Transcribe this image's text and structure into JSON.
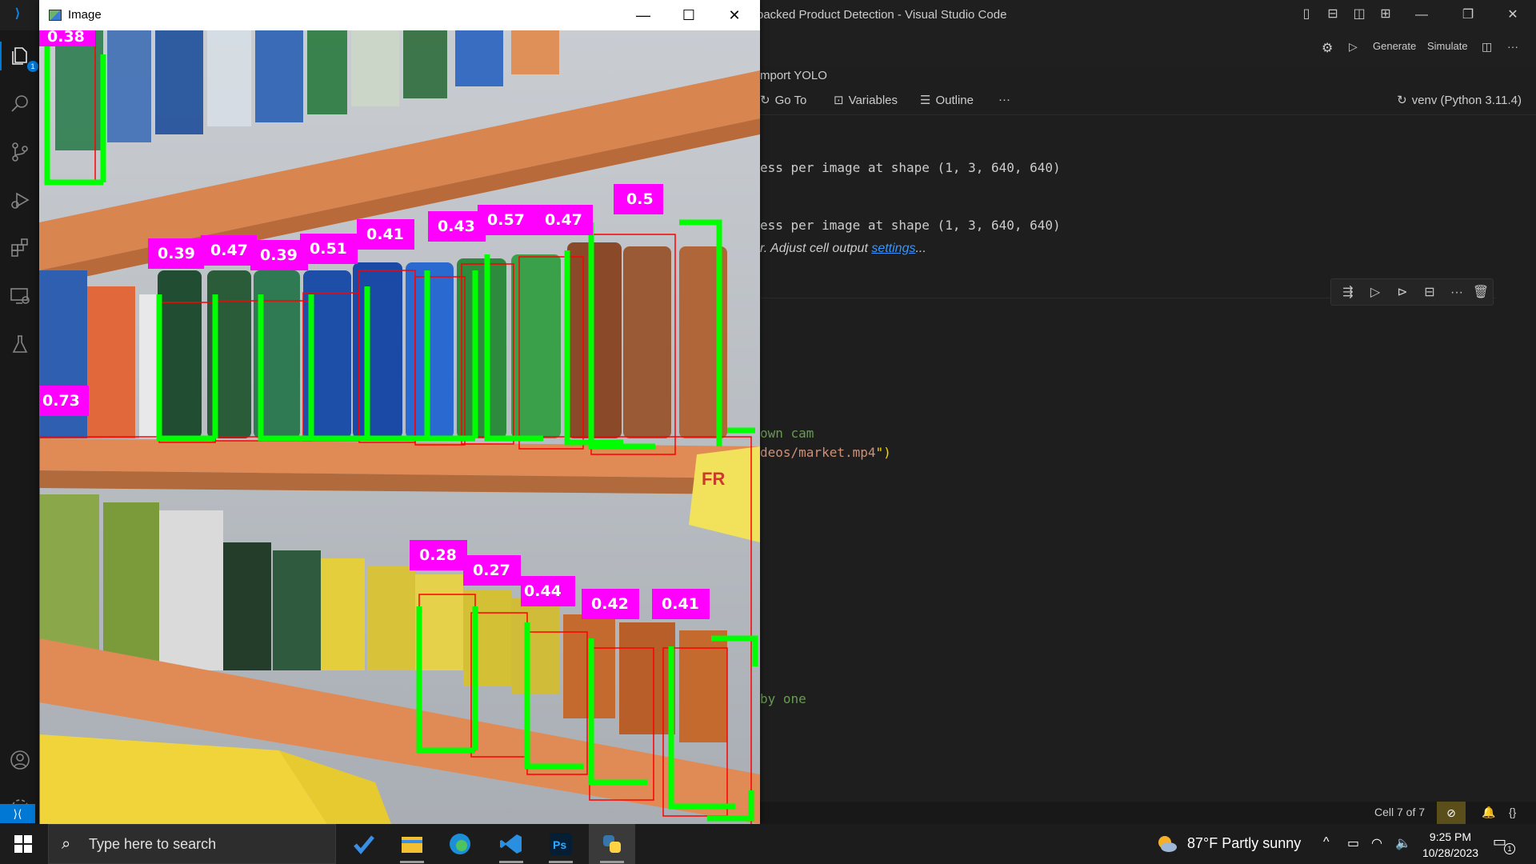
{
  "vscode": {
    "window_title": "packed Product Detection - Visual Studio Code",
    "toolbar": {
      "generate_label": "Generate",
      "simulate_label": "Simulate"
    },
    "breadcrumb": "mport YOLO",
    "nb_toolbar": {
      "goto_label": "Go To",
      "variables_label": "Variables",
      "outline_label": "Outline",
      "more": "···"
    },
    "kernel_label": "venv (Python 3.11.4)",
    "output": {
      "line1": "ess per image at shape (1, 3, 640, 640)",
      "line2": "ess per image at shape (1, 3, 640, 640)",
      "note_prefix": "r. Adjust cell output ",
      "note_link": "settings",
      "note_suffix": "..."
    },
    "code": {
      "line1": "own cam",
      "line2_a": "deos/market.mp4",
      "line2_b": "\")",
      "line3": "by one"
    },
    "activity_badge": "1",
    "status": {
      "cell_label": "Cell 7 of 7"
    },
    "colors": {
      "accent": "#0078d4",
      "bg": "#1e1e1e",
      "comment": "#6a9955",
      "string": "#ce9178"
    }
  },
  "image_window": {
    "title": "Image",
    "detections": [
      {
        "label": "0.38"
      },
      {
        "label": "0.39"
      },
      {
        "label": "0.47"
      },
      {
        "label": "0.39"
      },
      {
        "label": "0.51"
      },
      {
        "label": "0.41"
      },
      {
        "label": "0.43"
      },
      {
        "label": "0.57"
      },
      {
        "label": "0.47"
      },
      {
        "label": "0.5"
      },
      {
        "label": "0.73"
      },
      {
        "label": "0.28"
      },
      {
        "label": "0.27"
      },
      {
        "label": "0.44"
      },
      {
        "label": "0.42"
      },
      {
        "label": "0.41"
      }
    ],
    "colors": {
      "label_bg": "#ff00ff",
      "box_corner": "#00ff00",
      "box_line": "#ff0000"
    }
  },
  "taskbar": {
    "search_placeholder": "Type here to search",
    "weather": "87°F  Partly sunny",
    "time": "9:25 PM",
    "date": "10/28/2023",
    "notification_count": "1",
    "apps": [
      "task-view-icon",
      "file-explorer-icon",
      "edge-icon",
      "vscode-icon",
      "photoshop-icon",
      "python-icon"
    ]
  }
}
